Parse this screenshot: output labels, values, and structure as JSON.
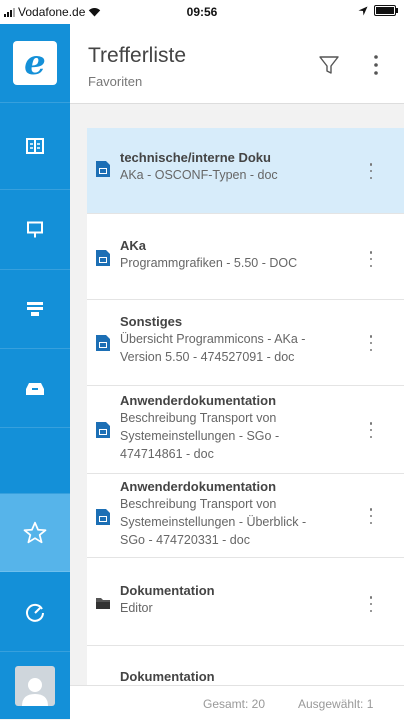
{
  "status_bar": {
    "carrier": "Vodafone.de",
    "time": "09:56"
  },
  "header": {
    "title": "Trefferliste",
    "subtitle": "Favoriten"
  },
  "list": [
    {
      "type": "doc",
      "title": "technische/interne Doku",
      "lines": [
        "AKa - OSCONF-Typen - doc"
      ],
      "selected": true
    },
    {
      "type": "doc",
      "title": "AKa",
      "lines": [
        "Programmgrafiken - 5.50 - DOC"
      ],
      "selected": false
    },
    {
      "type": "doc",
      "title": "Sonstiges",
      "lines": [
        "Übersicht Programmicons - AKa -",
        "Version 5.50 - 474527091 - doc"
      ],
      "selected": false
    },
    {
      "type": "doc",
      "title": "Anwenderdokumentation",
      "lines": [
        "Beschreibung Transport von",
        "Systemeinstellungen - SGo -",
        "474714861 - doc"
      ],
      "selected": false
    },
    {
      "type": "doc",
      "title": "Anwenderdokumentation",
      "lines": [
        "Beschreibung Transport von",
        "Systemeinstellungen - Überblick -",
        "SGo - 474720331 - doc"
      ],
      "selected": false
    },
    {
      "type": "folder",
      "title": "Dokumentation",
      "lines": [
        "Editor"
      ],
      "selected": false
    },
    {
      "type": "folder",
      "title": "Dokumentation",
      "lines": [],
      "selected": false
    }
  ],
  "footer": {
    "total": "Gesamt: 20",
    "selected": "Ausgewählt: 1"
  },
  "colors": {
    "sidebar": "#1490d8",
    "sidebar_active": "#56b4ea",
    "row_selected": "#d7ecfa"
  }
}
